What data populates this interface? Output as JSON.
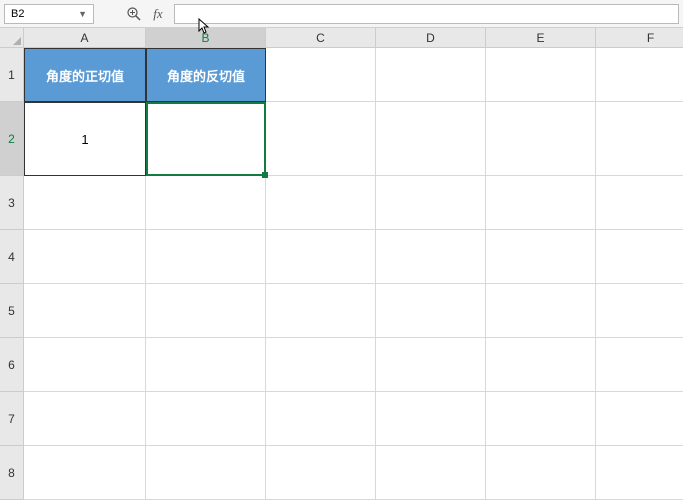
{
  "nameBox": {
    "value": "B2"
  },
  "formulaInput": {
    "value": ""
  },
  "columns": [
    "A",
    "B",
    "C",
    "D",
    "E",
    "F"
  ],
  "activeColumn": "B",
  "rows": [
    "1",
    "2",
    "3",
    "4",
    "5",
    "6",
    "7",
    "8"
  ],
  "activeRow": "2",
  "colWidths": {
    "A": 122,
    "B": 120,
    "C": 110,
    "D": 110,
    "E": 110,
    "F": 110
  },
  "rowHeights": {
    "1": 54,
    "2": 74,
    "3": 54,
    "4": 54,
    "5": 54,
    "6": 54,
    "7": 54,
    "8": 54
  },
  "cells": {
    "A1": "角度的正切值",
    "B1": "角度的反切值",
    "A2": "1",
    "B2": ""
  },
  "selectedCell": "B2"
}
